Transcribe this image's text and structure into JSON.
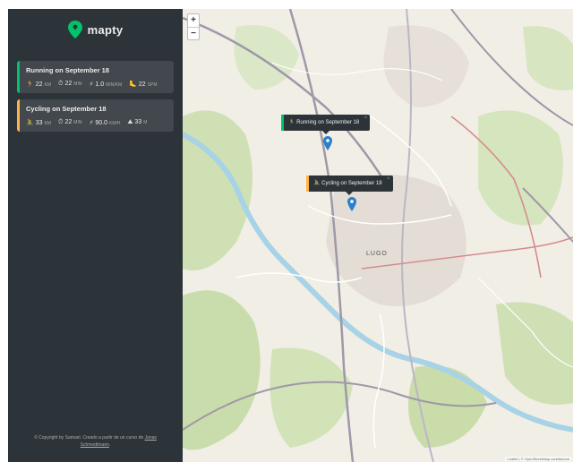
{
  "app": {
    "name": "mapty"
  },
  "workouts": [
    {
      "type": "running",
      "title": "Running on September 18",
      "details": [
        {
          "icon": "runner-icon",
          "glyph": "🏃",
          "value": "22",
          "unit": "km"
        },
        {
          "icon": "stopwatch-icon",
          "glyph": "⏱",
          "value": "22",
          "unit": "min"
        },
        {
          "icon": "lightning-icon",
          "glyph": "⚡",
          "value": "1.0",
          "unit": "min/km"
        },
        {
          "icon": "footprint-icon",
          "glyph": "🦶",
          "value": "22",
          "unit": "spm"
        }
      ]
    },
    {
      "type": "cycling",
      "title": "Cycling on September 18",
      "details": [
        {
          "icon": "cyclist-icon",
          "glyph": "🚴",
          "value": "33",
          "unit": "km"
        },
        {
          "icon": "stopwatch-icon",
          "glyph": "⏱",
          "value": "22",
          "unit": "min"
        },
        {
          "icon": "lightning-icon",
          "glyph": "⚡",
          "value": "90.0",
          "unit": "km/h"
        },
        {
          "icon": "mountain-icon",
          "glyph": "⛰",
          "value": "33",
          "unit": "m"
        }
      ]
    }
  ],
  "footer": {
    "copyright_text": "© Copyright by Samuel. Creado a partir de un curso de",
    "link_text": "Jonas Schmedtmann",
    "suffix": "."
  },
  "map": {
    "zoom_in": "+",
    "zoom_out": "−",
    "city_label": "LUGO",
    "attribution": "Leaflet | © OpenStreetMap contributors",
    "popups": [
      {
        "type": "running",
        "glyph": "🏃",
        "text": "Running on September 18",
        "close": "×"
      },
      {
        "type": "cycling",
        "glyph": "🚴",
        "text": "Cycling on September 18",
        "close": "×"
      }
    ]
  },
  "colors": {
    "sidebar_bg": "#2d3439",
    "card_bg": "#42484d",
    "running": "#00c46a",
    "cycling": "#ffb545",
    "marker": "#2a81cb"
  }
}
